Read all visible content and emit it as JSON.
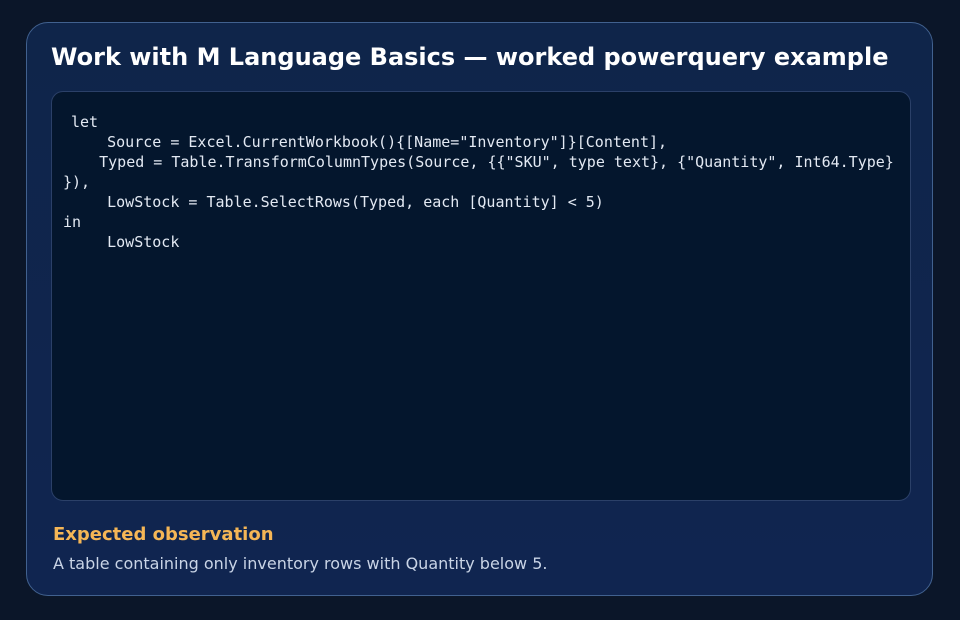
{
  "card": {
    "title": "Work with M Language Basics — worked powerquery example"
  },
  "code": {
    "lines": [
      "let",
      "    Source = Excel.CurrentWorkbook(){[Name=\"Inventory\"]}[Content],",
      "    Typed = Table.TransformColumnTypes(Source, {{\"SKU\", type text}, {\"Quantity\", Int64.Type}",
      "}),",
      "    LowStock = Table.SelectRows(Typed, each [Quantity] < 5)",
      "in",
      "    LowStock"
    ]
  },
  "observation": {
    "heading": "Expected observation",
    "text": "A table containing only inventory rows with Quantity below 5."
  }
}
